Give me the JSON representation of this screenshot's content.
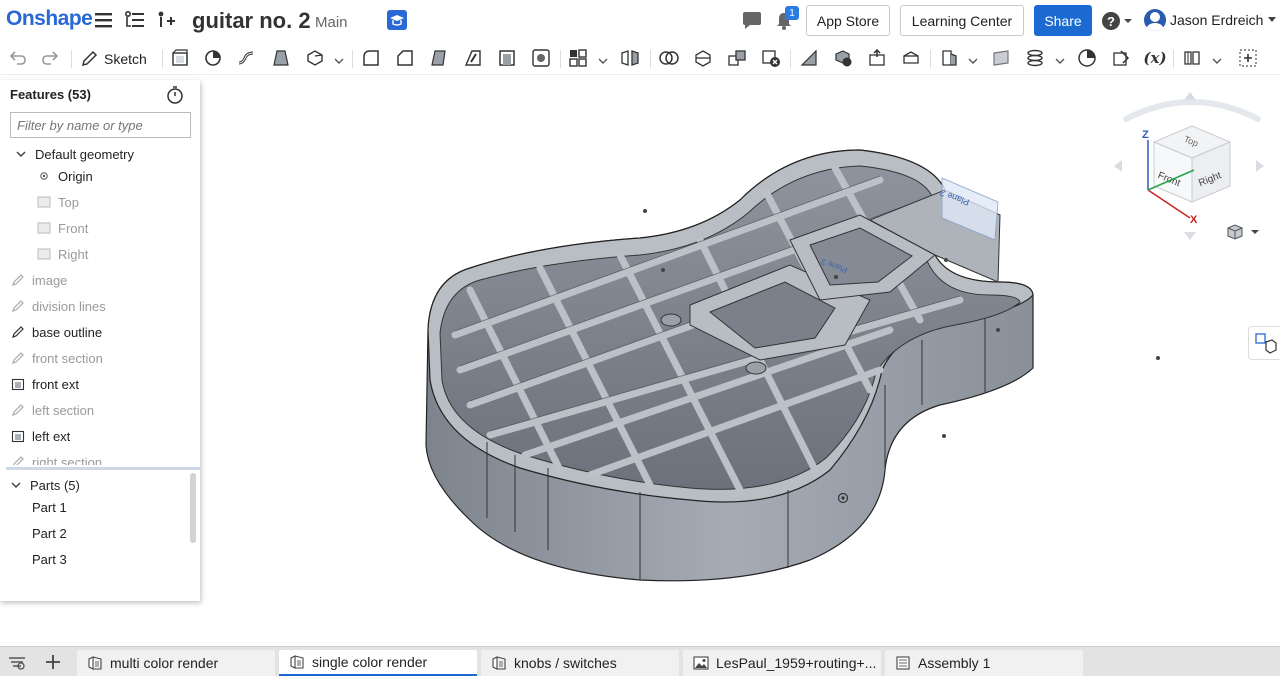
{
  "app": {
    "logo": "Onshape",
    "document_title": "guitar no. 2",
    "branch": "Main",
    "notifications_count": "1",
    "buttons": {
      "app_store": "App Store",
      "learning_center": "Learning Center",
      "share": "Share"
    },
    "user_name": "Jason Erdreich"
  },
  "toolbar": {
    "sketch_label": "Sketch",
    "variable_label": "(x)"
  },
  "features": {
    "title": "Features (53)",
    "filter_placeholder": "Filter by name or type",
    "default_geometry_label": "Default geometry",
    "items": [
      {
        "label": "Origin",
        "state": "normal",
        "icon": "origin-icon"
      },
      {
        "label": "Top",
        "state": "dim",
        "icon": "plane-icon"
      },
      {
        "label": "Front",
        "state": "dim",
        "icon": "plane-icon"
      },
      {
        "label": "Right",
        "state": "dim",
        "icon": "plane-icon"
      },
      {
        "label": "image",
        "state": "dim",
        "icon": "sketch-icon"
      },
      {
        "label": "division lines",
        "state": "dim",
        "icon": "sketch-icon"
      },
      {
        "label": "base outline",
        "state": "normal",
        "icon": "sketch-icon"
      },
      {
        "label": "front section",
        "state": "dim",
        "icon": "sketch-icon"
      },
      {
        "label": "front ext",
        "state": "normal",
        "icon": "extrude-icon"
      },
      {
        "label": "left section",
        "state": "dim",
        "icon": "sketch-icon"
      },
      {
        "label": "left ext",
        "state": "normal",
        "icon": "extrude-icon"
      },
      {
        "label": "right section",
        "state": "dim",
        "icon": "sketch-icon"
      }
    ],
    "parts_label": "Parts (5)",
    "parts": [
      "Part 1",
      "Part 2",
      "Part 3"
    ]
  },
  "view_cube": {
    "faces": {
      "top": "Top",
      "front": "Front",
      "right": "Right"
    },
    "axes": {
      "z": "Z",
      "x": "X"
    }
  },
  "model_labels": {
    "plane_2": "Plane 2",
    "plane_3": "Plane 3"
  },
  "tabs": [
    {
      "label": "multi color render",
      "icon": "part-studio-icon"
    },
    {
      "label": "single color render",
      "icon": "part-studio-icon",
      "active": true
    },
    {
      "label": "knobs / switches",
      "icon": "part-studio-icon"
    },
    {
      "label": "LesPaul_1959+routing+...",
      "icon": "image-icon"
    },
    {
      "label": "Assembly 1",
      "icon": "assembly-icon"
    }
  ],
  "colors": {
    "accent": "#1a6ad2",
    "logo": "#2a68d6",
    "model": "#a7adb6",
    "model_dark": "#7d848e"
  }
}
